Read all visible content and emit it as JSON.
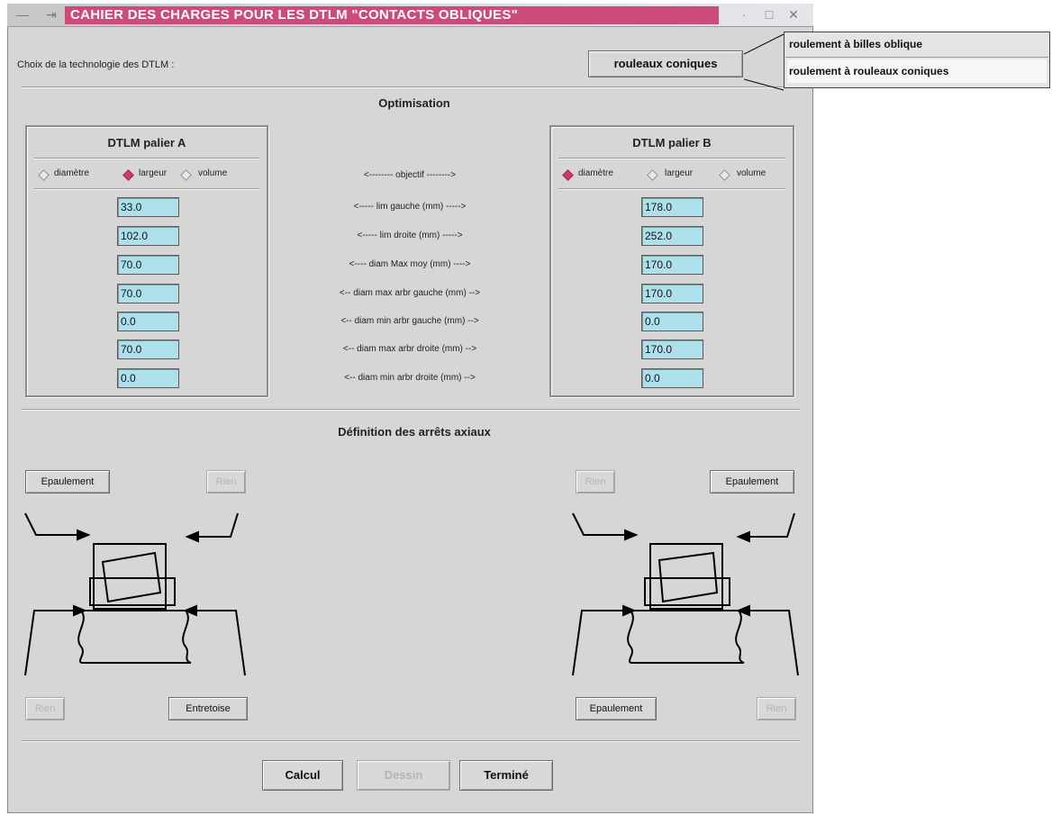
{
  "window": {
    "title": "CAHIER DES CHARGES POUR LES DTLM \"CONTACTS OBLIQUES\"",
    "menu_glyph": "—",
    "pin_glyph": "⇥",
    "min_glyph": "·",
    "max_glyph": "□",
    "close_glyph": "✕"
  },
  "techno": {
    "label": "Choix de la technologie des DTLM :",
    "selected": "rouleaux coniques",
    "options": [
      "roulement à billes oblique",
      "roulement à rouleaux coniques"
    ]
  },
  "optimisation": {
    "title": "Optimisation",
    "palier_a": {
      "title": "DTLM palier A",
      "radios": [
        {
          "label": "diamètre",
          "checked": false
        },
        {
          "label": "largeur",
          "checked": true
        },
        {
          "label": "volume",
          "checked": false
        }
      ],
      "values": [
        "33.0",
        "102.0",
        "70.0",
        "70.0",
        "0.0",
        "70.0",
        "0.0"
      ]
    },
    "palier_b": {
      "title": "DTLM palier B",
      "radios": [
        {
          "label": "diamètre",
          "checked": true
        },
        {
          "label": "largeur",
          "checked": false
        },
        {
          "label": "volume",
          "checked": false
        }
      ],
      "values": [
        "178.0",
        "252.0",
        "170.0",
        "170.0",
        "0.0",
        "170.0",
        "0.0"
      ]
    },
    "center_labels": [
      "<--------  objectif  -------->",
      "<-----  lim gauche (mm)  ----->",
      "<-----  lim droite (mm)  ----->",
      "<----  diam Max moy (mm)  ---->",
      "<-- diam max arbr gauche (mm) -->",
      "<-- diam min arbr gauche (mm) -->",
      "<-- diam max arbr droite (mm) -->",
      "<-- diam min arbr droite (mm) -->"
    ]
  },
  "arrets": {
    "title": "Définition des arrêts axiaux",
    "a": {
      "top_left": "Epaulement",
      "top_right": "Rien",
      "bottom_left": "Rien",
      "bottom_right": "Entretoise"
    },
    "b": {
      "top_left": "Rien",
      "top_right": "Epaulement",
      "bottom_left": "Epaulement",
      "bottom_right": "Rien"
    }
  },
  "actions": {
    "calcul": "Calcul",
    "dessin": "Dessin",
    "termine": "Terminé"
  }
}
